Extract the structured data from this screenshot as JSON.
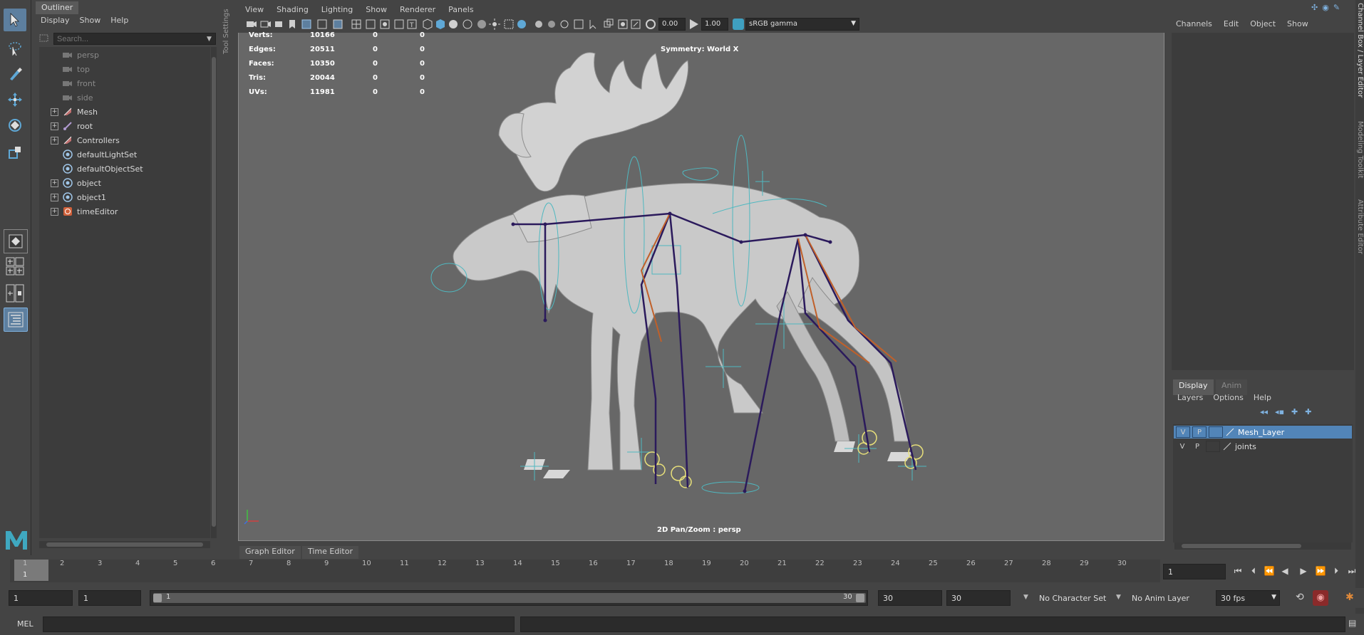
{
  "outliner": {
    "tab": "Outliner",
    "menu": [
      "Display",
      "Show",
      "Help"
    ],
    "search_placeholder": "Search...",
    "items": [
      {
        "label": "persp",
        "dim": true
      },
      {
        "label": "top",
        "dim": true
      },
      {
        "label": "front",
        "dim": true
      },
      {
        "label": "side",
        "dim": true
      },
      {
        "label": "Mesh",
        "dim": false
      },
      {
        "label": "root",
        "dim": false
      },
      {
        "label": "Controllers",
        "dim": false
      },
      {
        "label": "defaultLightSet",
        "dim": false
      },
      {
        "label": "defaultObjectSet",
        "dim": false
      },
      {
        "label": "object",
        "dim": false
      },
      {
        "label": "object1",
        "dim": false
      },
      {
        "label": "timeEditor",
        "dim": false
      }
    ]
  },
  "tool_settings_label": "Tool Settings",
  "viewport": {
    "menu": [
      "View",
      "Shading",
      "Lighting",
      "Show",
      "Renderer",
      "Panels"
    ],
    "exposure": "0.00",
    "gamma": "1.00",
    "color_space": "sRGB gamma",
    "symmetry": "Symmetry: World X",
    "camera_label": "2D Pan/Zoom : persp",
    "stats": [
      {
        "label": "Verts:",
        "v1": "10166",
        "v2": "0",
        "v3": "0"
      },
      {
        "label": "Edges:",
        "v1": "20511",
        "v2": "0",
        "v3": "0"
      },
      {
        "label": "Faces:",
        "v1": "10350",
        "v2": "0",
        "v3": "0"
      },
      {
        "label": "Tris:",
        "v1": "20044",
        "v2": "0",
        "v3": "0"
      },
      {
        "label": "UVs:",
        "v1": "11981",
        "v2": "0",
        "v3": "0"
      }
    ]
  },
  "channel_box": {
    "menu": [
      "Channels",
      "Edit",
      "Object",
      "Show"
    ]
  },
  "side_tabs": [
    "Channel Box / Layer Editor",
    "Modeling Toolkit",
    "Attribute Editor"
  ],
  "layer_editor": {
    "tabs": [
      "Display",
      "Anim"
    ],
    "menu": [
      "Layers",
      "Options",
      "Help"
    ],
    "layers": [
      {
        "v": "V",
        "p": "P",
        "name": "Mesh_Layer",
        "selected": true
      },
      {
        "v": "V",
        "p": "P",
        "name": "joints",
        "selected": false
      }
    ]
  },
  "bottom_tabs": [
    "Graph Editor",
    "Time Editor"
  ],
  "timeline": {
    "ticks": [
      "1",
      "2",
      "3",
      "4",
      "5",
      "6",
      "7",
      "8",
      "9",
      "10",
      "11",
      "12",
      "13",
      "14",
      "15",
      "16",
      "17",
      "18",
      "19",
      "20",
      "21",
      "22",
      "23",
      "24",
      "25",
      "26",
      "27",
      "28",
      "29",
      "30"
    ],
    "current_frame": "1",
    "current_frame_field": "1"
  },
  "range": {
    "start": "1",
    "playback_start": "1",
    "slider_start": "1",
    "slider_end": "30",
    "playback_end": "30",
    "end": "30",
    "character_set": "No Character Set",
    "anim_layer": "No Anim Layer",
    "fps": "30 fps"
  },
  "cmdline": {
    "label": "MEL"
  },
  "colors": {
    "accent": "#5d7f9f",
    "selected_layer": "#5285b8",
    "rig_cyan": "#4fb8c0",
    "rig_purple": "#2b1a5c",
    "rig_orange": "#c0602a"
  }
}
